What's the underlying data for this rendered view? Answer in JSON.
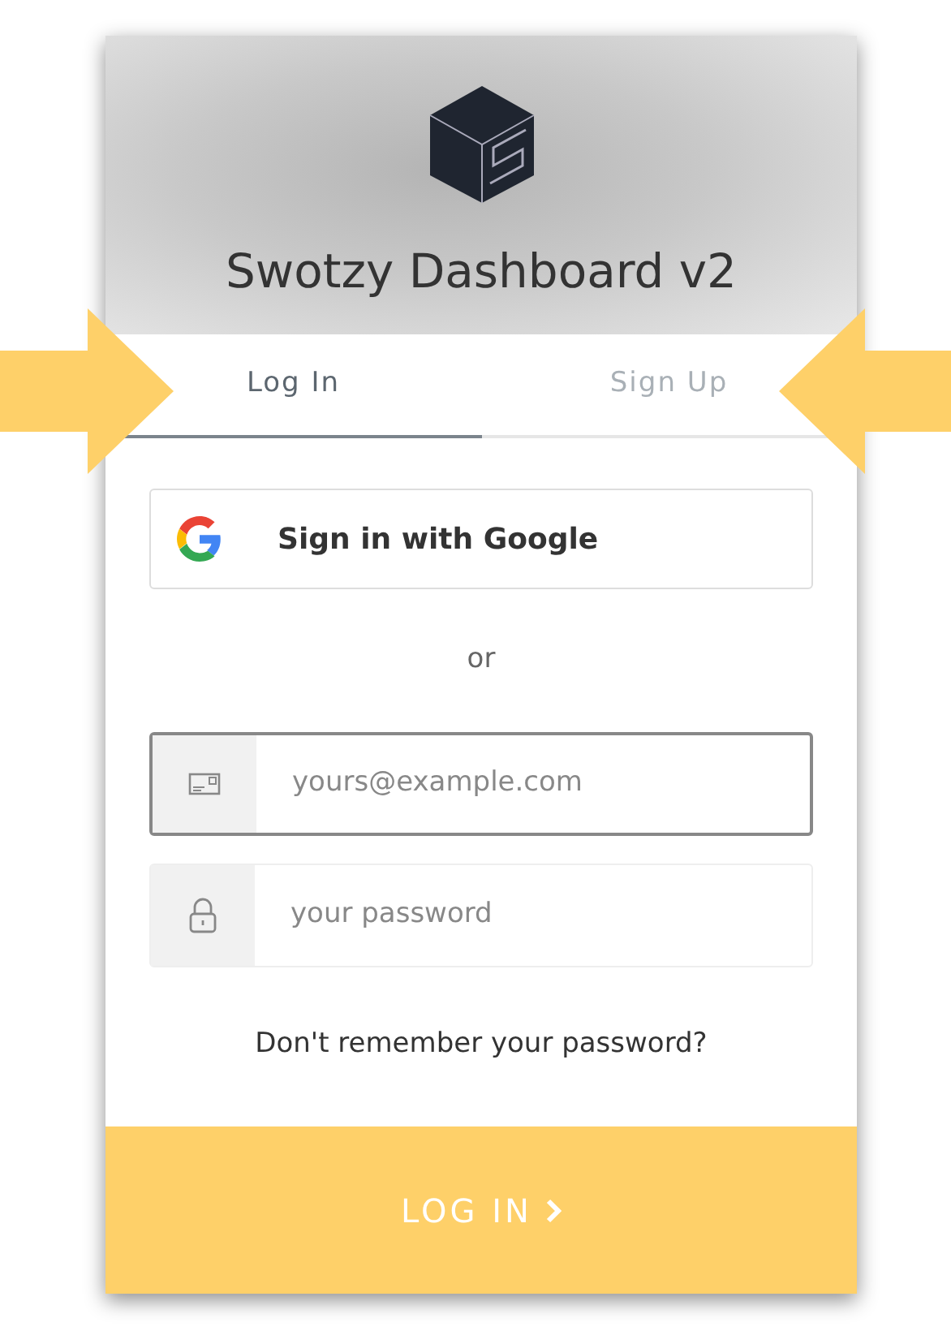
{
  "header": {
    "title": "Swotzy Dashboard v2"
  },
  "tabs": [
    {
      "label": "Log In",
      "selected": true
    },
    {
      "label": "Sign Up",
      "selected": false
    }
  ],
  "social_button": {
    "label": "Sign in with Google"
  },
  "separator": "or",
  "fields": [
    {
      "kind": "email",
      "placeholder": "yours@example.com",
      "focused": true
    },
    {
      "kind": "password",
      "placeholder": "your password",
      "focused": false
    }
  ],
  "forgot_link": "Don't remember your password?",
  "submit_button": {
    "label": "LOG IN"
  }
}
